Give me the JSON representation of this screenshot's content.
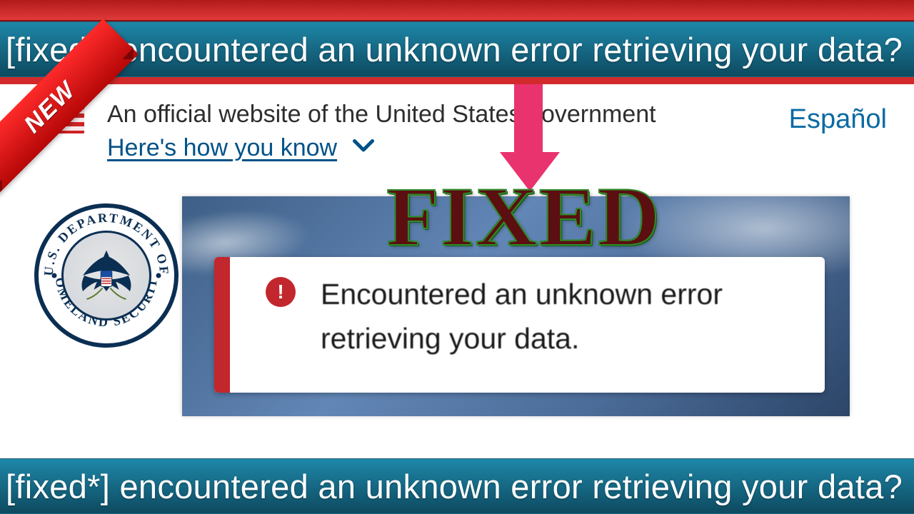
{
  "top_banner": "[fixed*] encountered an unknown error retrieving your data?",
  "bottom_banner": "[fixed*] encountered an unknown error retrieving your data?",
  "ribbon": "NEW",
  "gov": {
    "official_line": "An official website of the United States government",
    "how_link": "Here's how you know",
    "espanol": "Español"
  },
  "seal": {
    "top_text": "U.S. DEPARTMENT OF",
    "bottom_text": "HOMELAND SECURITY"
  },
  "fixed_stamp": "FIXED",
  "error": {
    "icon": "!",
    "message": "Encountered an unknown error retrieving your data."
  }
}
